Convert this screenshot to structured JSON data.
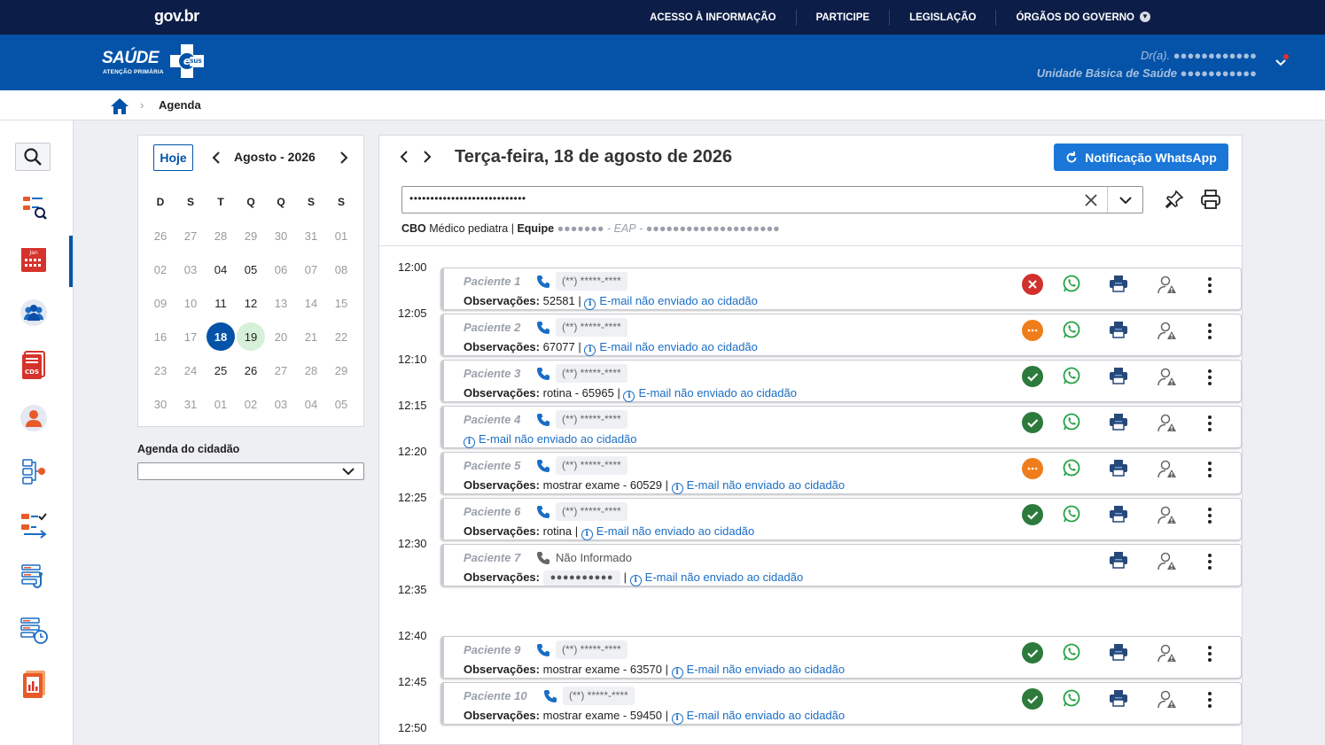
{
  "gov": {
    "logo": "gov.br",
    "links": [
      "ACESSO À INFORMAÇÃO",
      "PARTICIPE",
      "LEGISLAÇÃO",
      "ÓRGÃOS DO GOVERNO"
    ]
  },
  "brand": {
    "name": "SAÚDE",
    "subtitle": "ATENÇÃO PRIMÁRIA",
    "badge": "sus",
    "user_line1": "Dr(a). ●●●●●●●●●●●●",
    "user_line2": "Unidade Básica de Saúde ●●●●●●●●●●●"
  },
  "breadcrumb": {
    "current": "Agenda",
    "separator": "›"
  },
  "calendar": {
    "today_label": "Hoje",
    "month": "Agosto - 2026",
    "weekdays": [
      "D",
      "S",
      "T",
      "Q",
      "Q",
      "S",
      "S"
    ],
    "weeks": [
      [
        "26",
        "27",
        "28",
        "29",
        "30",
        "31",
        "01"
      ],
      [
        "02",
        "03",
        "04",
        "05",
        "06",
        "07",
        "08"
      ],
      [
        "09",
        "10",
        "11",
        "12",
        "13",
        "14",
        "15"
      ],
      [
        "16",
        "17",
        "18",
        "19",
        "20",
        "21",
        "22"
      ],
      [
        "23",
        "24",
        "25",
        "26",
        "27",
        "28",
        "29"
      ],
      [
        "30",
        "31",
        "01",
        "02",
        "03",
        "04",
        "05"
      ]
    ],
    "selected": "18",
    "highlighted": "19",
    "current_month_dates": [
      "04",
      "05",
      "11",
      "12",
      "18",
      "19",
      "25",
      "26"
    ]
  },
  "citizen_agenda": {
    "label": "Agenda do cidadão",
    "value": ""
  },
  "day": {
    "title": "Terça-feira, 18 de agosto de 2026",
    "whatsapp_button": "Notificação WhatsApp",
    "professional_value": "••••••••••••••••••••••••••••",
    "cbo_label": "CBO",
    "cbo_value": "Médico pediatra",
    "team_label": "Equipe",
    "team_value": "●●●●●●●",
    "eap_label": "EAP",
    "eap_value": "●●●●●●●●●●●●●●●●●●●●"
  },
  "times": [
    "12:00",
    "12:05",
    "12:10",
    "12:15",
    "12:20",
    "12:25",
    "12:30",
    "12:35",
    "12:40",
    "12:45",
    "12:50"
  ],
  "appointments": [
    {
      "name": "Paciente 1",
      "phone": "(**) *****-****",
      "obs_label": "Observações:",
      "obs": "52581",
      "email_note": "E-mail não enviado ao cidadão",
      "status": "cancelled"
    },
    {
      "name": "Paciente 2",
      "phone": "(**) *****-****",
      "obs_label": "Observações:",
      "obs": "67077",
      "email_note": "E-mail não enviado ao cidadão",
      "status": "waiting"
    },
    {
      "name": "Paciente 3",
      "phone": "(**) *****-****",
      "obs_label": "Observações:",
      "obs": "rotina - 65965",
      "email_note": "E-mail não enviado ao cidadão",
      "status": "confirmed"
    },
    {
      "name": "Paciente 4",
      "phone": "(**) *****-****",
      "obs_label": "",
      "obs": "",
      "email_note": "E-mail não enviado ao cidadão",
      "status": "confirmed"
    },
    {
      "name": "Paciente 5",
      "phone": "(**) *****-****",
      "obs_label": "Observações:",
      "obs": "mostrar exame - 60529",
      "email_note": "E-mail não enviado ao cidadão",
      "status": "waiting"
    },
    {
      "name": "Paciente 6",
      "phone": "(**) *****-****",
      "obs_label": "Observações:",
      "obs": "rotina",
      "email_note": "E-mail não enviado ao cidadão",
      "status": "confirmed"
    },
    {
      "name": "Paciente 7",
      "phone": "Não Informado",
      "obs_label": "Observações:",
      "obs": "●●●●●●●●●●",
      "email_note": "E-mail não enviado ao cidadão",
      "status": "none"
    },
    {
      "name": "Paciente 9",
      "phone": "(**) *****-****",
      "obs_label": "Observações:",
      "obs": "mostrar exame - 63570",
      "email_note": "E-mail não enviado ao cidadão",
      "status": "confirmed"
    },
    {
      "name": "Paciente 10",
      "phone": "(**) *****-****",
      "obs_label": "Observações:",
      "obs": "mostrar exame - 59450",
      "email_note": "E-mail não enviado ao cidadão",
      "status": "confirmed"
    }
  ],
  "sidebar_icons": [
    "search-icon",
    "citizen-search-icon",
    "calendar-icon",
    "group-icon",
    "cds-form-icon",
    "profile-icon",
    "flow-icon",
    "checklist-icon",
    "medical-list-icon",
    "scheduled-list-icon",
    "report-icon"
  ],
  "colors": {
    "gov_bar": "#0c1d47",
    "brand_bar": "#0453a8",
    "accent": "#1a76d7",
    "confirmed": "#2c7a3c",
    "waiting": "#f07d1b",
    "cancelled": "#d0312d",
    "whatsapp": "#25a244"
  }
}
